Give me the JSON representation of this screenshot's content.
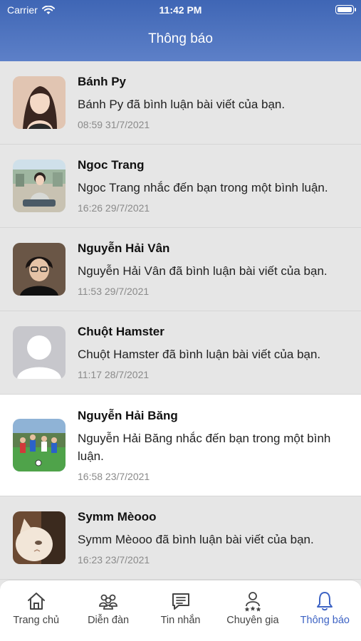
{
  "status_bar": {
    "carrier": "Carrier",
    "time": "11:42 PM"
  },
  "header": {
    "title": "Thông báo"
  },
  "notifications": [
    {
      "name": "Bánh Py",
      "message": "Bánh Py đã bình luận bài viết của bạn.",
      "time": "08:59 31/7/2021",
      "avatar": "woman-portrait",
      "unread": false
    },
    {
      "name": "Ngoc Trang",
      "message": "Ngoc Trang nhắc đến bạn trong một bình luận.",
      "time": "16:26 29/7/2021",
      "avatar": "woman-sitting-outdoors",
      "unread": false
    },
    {
      "name": "Nguyễn Hải Vân",
      "message": "Nguyễn Hải Vân đã bình luận bài viết của bạn.",
      "time": "11:53 29/7/2021",
      "avatar": "person-dark-portrait",
      "unread": false
    },
    {
      "name": "Chuột Hamster",
      "message": "Chuột Hamster đã bình luận bài viết của bạn.",
      "time": "11:17 28/7/2021",
      "avatar": "default-user",
      "unread": false
    },
    {
      "name": "Nguyễn Hải Băng",
      "message": "Nguyễn Hải Băng nhắc đến bạn trong một bình luận.",
      "time": "16:58 23/7/2021",
      "avatar": "football-team",
      "unread": true
    },
    {
      "name": "Symm Mèooo",
      "message": "Symm Mèooo đã bình luận bài viết của bạn.",
      "time": "16:23 23/7/2021",
      "avatar": "cat-photo",
      "unread": false
    }
  ],
  "tabs": [
    {
      "label": "Trang chủ",
      "icon": "home-icon",
      "active": false
    },
    {
      "label": "Diễn đàn",
      "icon": "forum-icon",
      "active": false
    },
    {
      "label": "Tin nhắn",
      "icon": "message-icon",
      "active": false
    },
    {
      "label": "Chuyên gia",
      "icon": "expert-icon",
      "active": false
    },
    {
      "label": "Thông báo",
      "icon": "bell-icon",
      "active": true
    }
  ],
  "colors": {
    "header_top": "#3f66b5",
    "header_bottom": "#5d80c8",
    "accent": "#3d63c4",
    "read_bg": "#e6e6e6",
    "unread_bg": "#ffffff"
  }
}
